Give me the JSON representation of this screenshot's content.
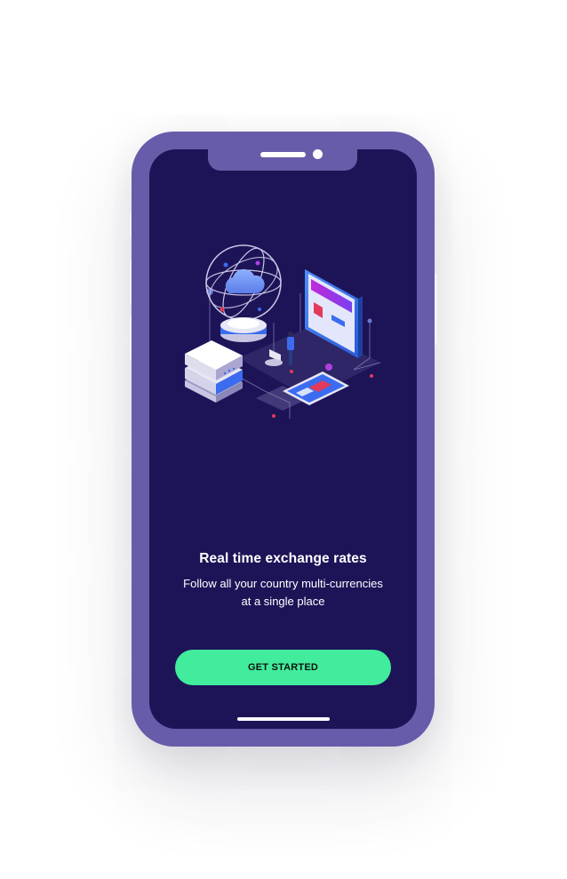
{
  "onboarding": {
    "title": "Real time exchange rates",
    "subtitle_line1": "Follow all your country multi-currencies",
    "subtitle_line2": "at a single place",
    "cta_label": "GET STARTED"
  },
  "colors": {
    "phone_frame": "#665ca9",
    "screen_background": "#1d1458",
    "cta_background": "#41ec9c",
    "text_primary": "#ffffff"
  },
  "icons": {
    "illustration": "isometric-network-cloud-server-illustration"
  }
}
